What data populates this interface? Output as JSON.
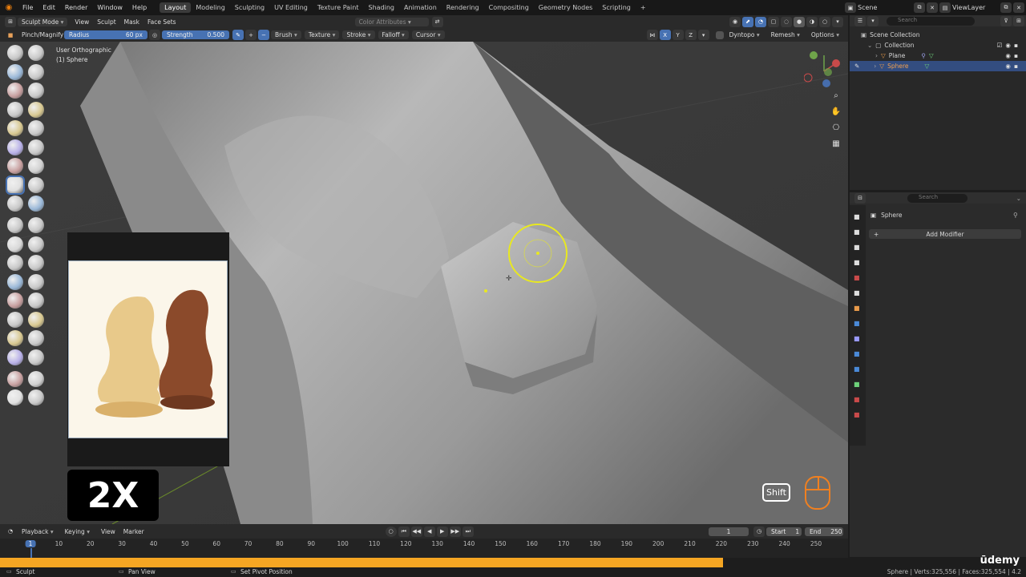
{
  "menu": [
    "File",
    "Edit",
    "Render",
    "Window",
    "Help"
  ],
  "workspaces": [
    "Layout",
    "Modeling",
    "Sculpting",
    "UV Editing",
    "Texture Paint",
    "Shading",
    "Animation",
    "Rendering",
    "Compositing",
    "Geometry Nodes",
    "Scripting"
  ],
  "active_workspace": "Layout",
  "scene": {
    "name": "Scene",
    "view_layer": "ViewLayer"
  },
  "header": {
    "mode": "Sculpt Mode",
    "items": [
      "View",
      "Sculpt",
      "Mask",
      "Face Sets"
    ],
    "color_attr": "Color Attributes"
  },
  "toolsettings": {
    "brush_name": "Pinch/Magnify",
    "radius_label": "Radius",
    "radius_value": "60 px",
    "strength_label": "Strength",
    "strength_value": "0.500",
    "dropdowns": [
      "Brush",
      "Texture",
      "Stroke",
      "Falloff",
      "Cursor"
    ],
    "axes": [
      "X",
      "Y",
      "Z"
    ],
    "dyntopo": "Dyntopo",
    "remesh": "Remesh",
    "options": "Options"
  },
  "viewport": {
    "view_name": "User Orthographic",
    "object_name": "(1) Sphere",
    "speed_badge": "2X",
    "key_badge": "Shift"
  },
  "outliner": {
    "search_placeholder": "Search",
    "scene_collection": "Scene Collection",
    "collection": "Collection",
    "items": [
      "Plane",
      "Sphere"
    ]
  },
  "properties": {
    "search_placeholder": "Search",
    "object": "Sphere",
    "add_modifier": "Add Modifier"
  },
  "timeline": {
    "menus": [
      "Playback",
      "Keying",
      "View",
      "Marker"
    ],
    "current_frame": "1",
    "start_label": "Start",
    "start": "1",
    "end_label": "End",
    "end": "250",
    "ticks": [
      "1",
      "10",
      "20",
      "30",
      "40",
      "50",
      "60",
      "70",
      "80",
      "90",
      "100",
      "110",
      "120",
      "130",
      "140",
      "150",
      "160",
      "170",
      "180",
      "190",
      "200",
      "210",
      "220",
      "230",
      "240",
      "250"
    ]
  },
  "status": {
    "left": "Sculpt",
    "mid1": "Pan View",
    "mid2": "Set Pivot Position",
    "right": "Sphere | Verts:325,556 | Faces:325,554 | 4.2",
    "progress": 0.705,
    "watermark": "ūdemy"
  },
  "colors": {
    "accent": "#4772b3",
    "brush_ring": "#e8e820",
    "progress": "#f5a623"
  }
}
